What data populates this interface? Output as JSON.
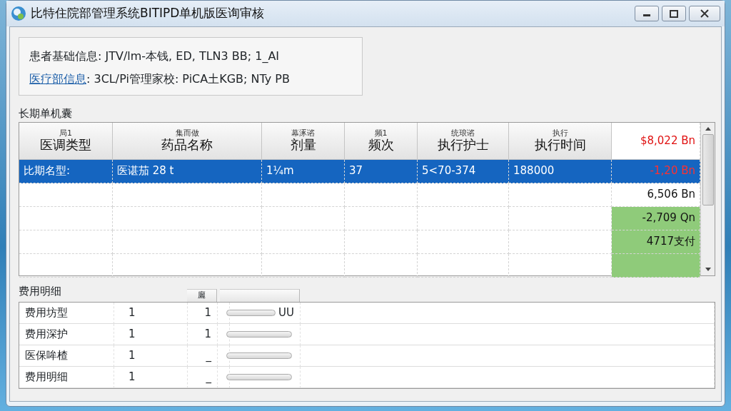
{
  "window": {
    "title": "比特住院部管理系统BITIPD单机版医询审核"
  },
  "patient_info": {
    "line_1": "患者基础信息: JTV/lm-本钱, ED, TLN3 BB; 1_AI",
    "link": "医疗部信息",
    "line_2": ": 3CL/Pi管理家校: PiCA土KGB; NTy PB"
  },
  "orders": {
    "title": "长期单机囊",
    "columns": [
      {
        "top": "局1",
        "label": "医调类型"
      },
      {
        "top": "集而做",
        "label": "药品名称"
      },
      {
        "top": "幕涿谘",
        "label": "剂量"
      },
      {
        "top": "频1",
        "label": "频次"
      },
      {
        "top": "统琅谘",
        "label": "执行护士"
      },
      {
        "top": "执行",
        "label": "执行时间"
      }
    ],
    "total": {
      "text": "$8,022 Bn",
      "color": "#e01010"
    },
    "rows": [
      {
        "selected": true,
        "cells": [
          "比期名型:",
          "医谌茄 28 t",
          "1¼m",
          "37",
          "5<70-374",
          "188000"
        ],
        "amount": "-1,20 Bn",
        "color": "#ff3030",
        "highlighted": false
      },
      {
        "selected": false,
        "amount": "6,506 Bn",
        "color": "#111111",
        "highlighted": false
      },
      {
        "selected": false,
        "amount": "-2,709 Qn",
        "color": "#111111",
        "highlighted": true
      },
      {
        "selected": false,
        "amount": "4717支付",
        "color": "#111111",
        "highlighted": true
      },
      {
        "selected": false,
        "highlighted": true
      }
    ]
  },
  "fees": {
    "title": "费用明细",
    "column_2": "廲",
    "rows": [
      {
        "name": "费用坊型",
        "count": "1",
        "value": "1",
        "level": 0,
        "note": "UU"
      },
      {
        "name": "费用深护",
        "count": "1",
        "value": "1",
        "level": 0
      },
      {
        "name": "医保哞楂",
        "count": "1",
        "value": "_",
        "level": 0
      },
      {
        "name": "费用明细",
        "count": "1",
        "value": "_",
        "level": 0
      }
    ]
  }
}
